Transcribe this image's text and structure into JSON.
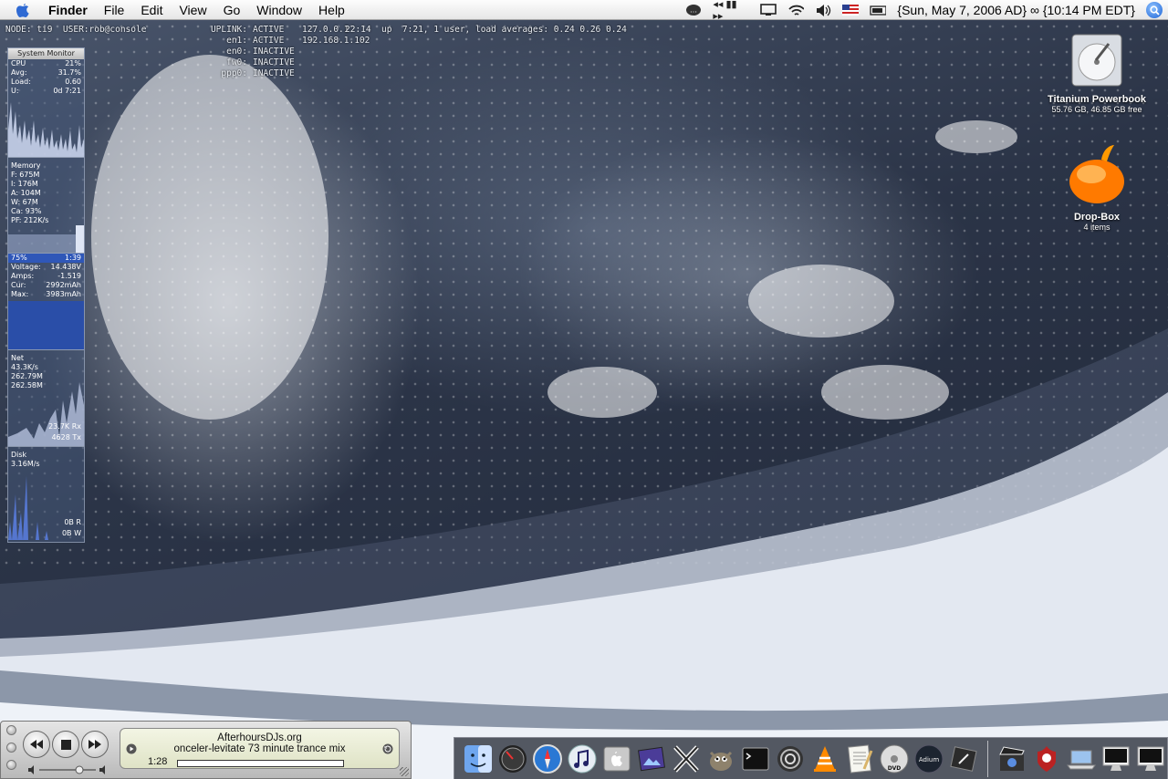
{
  "menubar": {
    "app_name": "Finder",
    "menus": [
      "File",
      "Edit",
      "View",
      "Go",
      "Window",
      "Help"
    ],
    "clock": "{Sun, May 7, 2006 AD} ∞ {10:14 PM EDT}",
    "status_icons": [
      "chat-icon",
      "itunes-controls-icon",
      "display-icon",
      "wifi-icon",
      "volume-icon",
      "us-flag-icon",
      "battery-icon",
      "spotlight-icon"
    ],
    "itunes_controls": "◂◂ ▮▮ ▸▸"
  },
  "terminal": {
    "node_line": "NODE: ti9  USER:rob@console",
    "uplink": [
      {
        "iface": "UPLINK:",
        "status": "ACTIVE",
        "ip": "127.0.0.1"
      },
      {
        "iface": "en1:",
        "status": "ACTIVE",
        "ip": "192.168.1.102"
      },
      {
        "iface": "en0:",
        "status": "INACTIVE",
        "ip": ""
      },
      {
        "iface": "fw0:",
        "status": "INACTIVE",
        "ip": ""
      },
      {
        "iface": "ppp0:",
        "status": "INACTIVE",
        "ip": ""
      }
    ],
    "uptime": "22:14  up  7:21, 1 user, load averages: 0.24 0.26 0.24"
  },
  "system_monitor": {
    "title": "System Monitor",
    "cpu": [
      {
        "k": "CPU",
        "v": "21%"
      },
      {
        "k": "Avg:",
        "v": "31.7%"
      },
      {
        "k": "Load:",
        "v": "0.60"
      },
      {
        "k": "U:",
        "v": "0d 7:21"
      }
    ],
    "memory": [
      {
        "k": "Memory",
        "v": ""
      },
      {
        "k": "F: 675M",
        "v": ""
      },
      {
        "k": "I: 176M",
        "v": ""
      },
      {
        "k": "A: 104M",
        "v": ""
      },
      {
        "k": "W: 67M",
        "v": ""
      },
      {
        "k": "Ca: 93%",
        "v": ""
      },
      {
        "k": "PF: 212K/s",
        "v": ""
      }
    ],
    "battery": {
      "percent": "75%",
      "time": "1:39",
      "rows": [
        {
          "k": "Voltage:",
          "v": "14.438V"
        },
        {
          "k": "Amps:",
          "v": "-1.519"
        },
        {
          "k": "Cur:",
          "v": "2992mAh"
        },
        {
          "k": "Max:",
          "v": "3983mAh"
        }
      ]
    },
    "net": {
      "label": "Net",
      "rate": "43.3K/s",
      "in_total": "262.79M",
      "out_total": "262.58M",
      "rx": "23.7K Rx",
      "tx": "4628 Tx"
    },
    "disk": {
      "label": "Disk",
      "rate": "3.16M/s",
      "read": "0B R",
      "write": "0B W"
    }
  },
  "desktop": {
    "hdd": {
      "title": "Titanium Powerbook",
      "sub": "55.76 GB, 46.85 GB free"
    },
    "dropbox": {
      "title": "Drop-Box",
      "sub": "4 items"
    }
  },
  "player": {
    "station": "AfterhoursDJs.org",
    "track": "onceler-levitate 73 minute trance mix",
    "elapsed": "1:28",
    "progress": 0.0
  },
  "dock": {
    "items": [
      "finder-icon",
      "dashboard-icon",
      "safari-icon",
      "itunes-icon",
      "system-prefs-icon",
      "iphoto-icon",
      "x11-icon",
      "gimp-icon",
      "terminal-icon",
      "rapidweaver-icon",
      "vlc-icon",
      "textedit-icon",
      "dvd-player-icon",
      "adium-icon",
      "keychain-icon"
    ],
    "adium_label": "Adium",
    "dvd_label": "DVD",
    "right_items": [
      "imovie-icon",
      "shield-cat-icon",
      "powerbook-icon",
      "imac-icon",
      "imac-2-icon",
      "trash-icon"
    ],
    "colors": {
      "safari": "#2a78d4",
      "vlc": "#ff8a00",
      "finder": "#3b7be0"
    }
  }
}
